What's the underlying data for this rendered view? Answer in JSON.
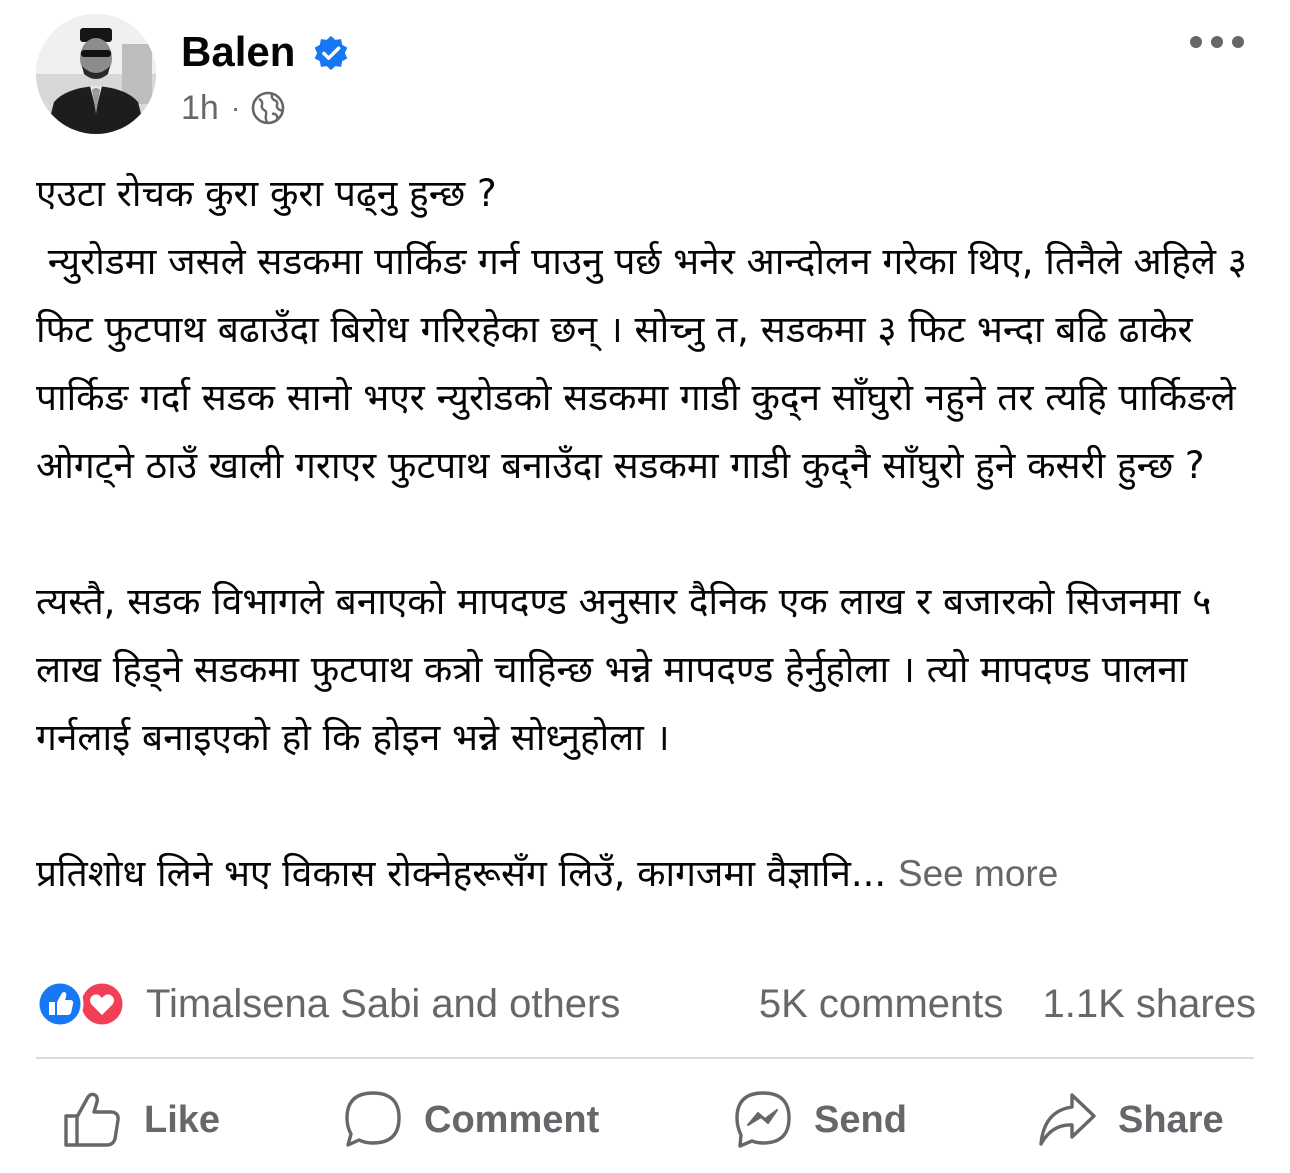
{
  "post": {
    "author": "Balen",
    "time": "1h",
    "separator": "·",
    "privacy_icon": "globe-icon",
    "verified_icon": "verified-badge-icon",
    "more_icon": "more-options-icon",
    "paragraphs": [
      "एउटा रोचक कुरा कुरा पढ्नु हुन्छ ?\n न्युरोडमा जसले सडकमा पार्किङ गर्न पाउनु पर्छ भनेर आन्दोलन गरेका थिए, तिनैले अहिले ३ फिट फुटपाथ बढाउँदा बिरोध गरिरहेका छन् । सोच्नु त, सडकमा ३ फिट भन्दा बढि ढाकेर पार्किङ गर्दा सडक सानो भएर न्युरोडको सडकमा गाडी कुद्न साँघुरो नहुने तर त्यहि पार्किङले ओगट्ने ठाउँ खाली गराएर फुटपाथ बनाउँदा सडकमा गाडी कुद्नै साँघुरो हुने कसरी हुन्छ ?",
      "त्यस्तै, सडक विभागले बनाएको मापदण्ड अनुसार दैनिक एक लाख र बजारको सिजनमा ५ लाख हिड्ने सडकमा फुटपाथ कत्रो चाहिन्छ भन्ने मापदण्ड हेर्नुहोला । त्यो मापदण्ड पालना गर्नलाई बनाइएको हो कि होइन भन्ने सोध्नुहोला ।"
    ],
    "truncated_paragraph": "प्रतिशोध लिने भए विकास रोक्नेहरूसँग लिउँ, कागजमा वैज्ञानि...",
    "see_more": "See more"
  },
  "engagement": {
    "reaction_icons": [
      "like-reaction-icon",
      "love-reaction-icon"
    ],
    "reactors": "Timalsena Sabi and others",
    "comments": "5K comments",
    "shares": "1.1K shares"
  },
  "actions": {
    "like": "Like",
    "comment": "Comment",
    "send": "Send",
    "share": "Share"
  },
  "colors": {
    "text": "#050505",
    "secondary": "#65676b",
    "verified_blue": "#1877f2",
    "like_blue": "#1877f2",
    "love_red": "#f33e58",
    "divider": "#dadde1"
  }
}
